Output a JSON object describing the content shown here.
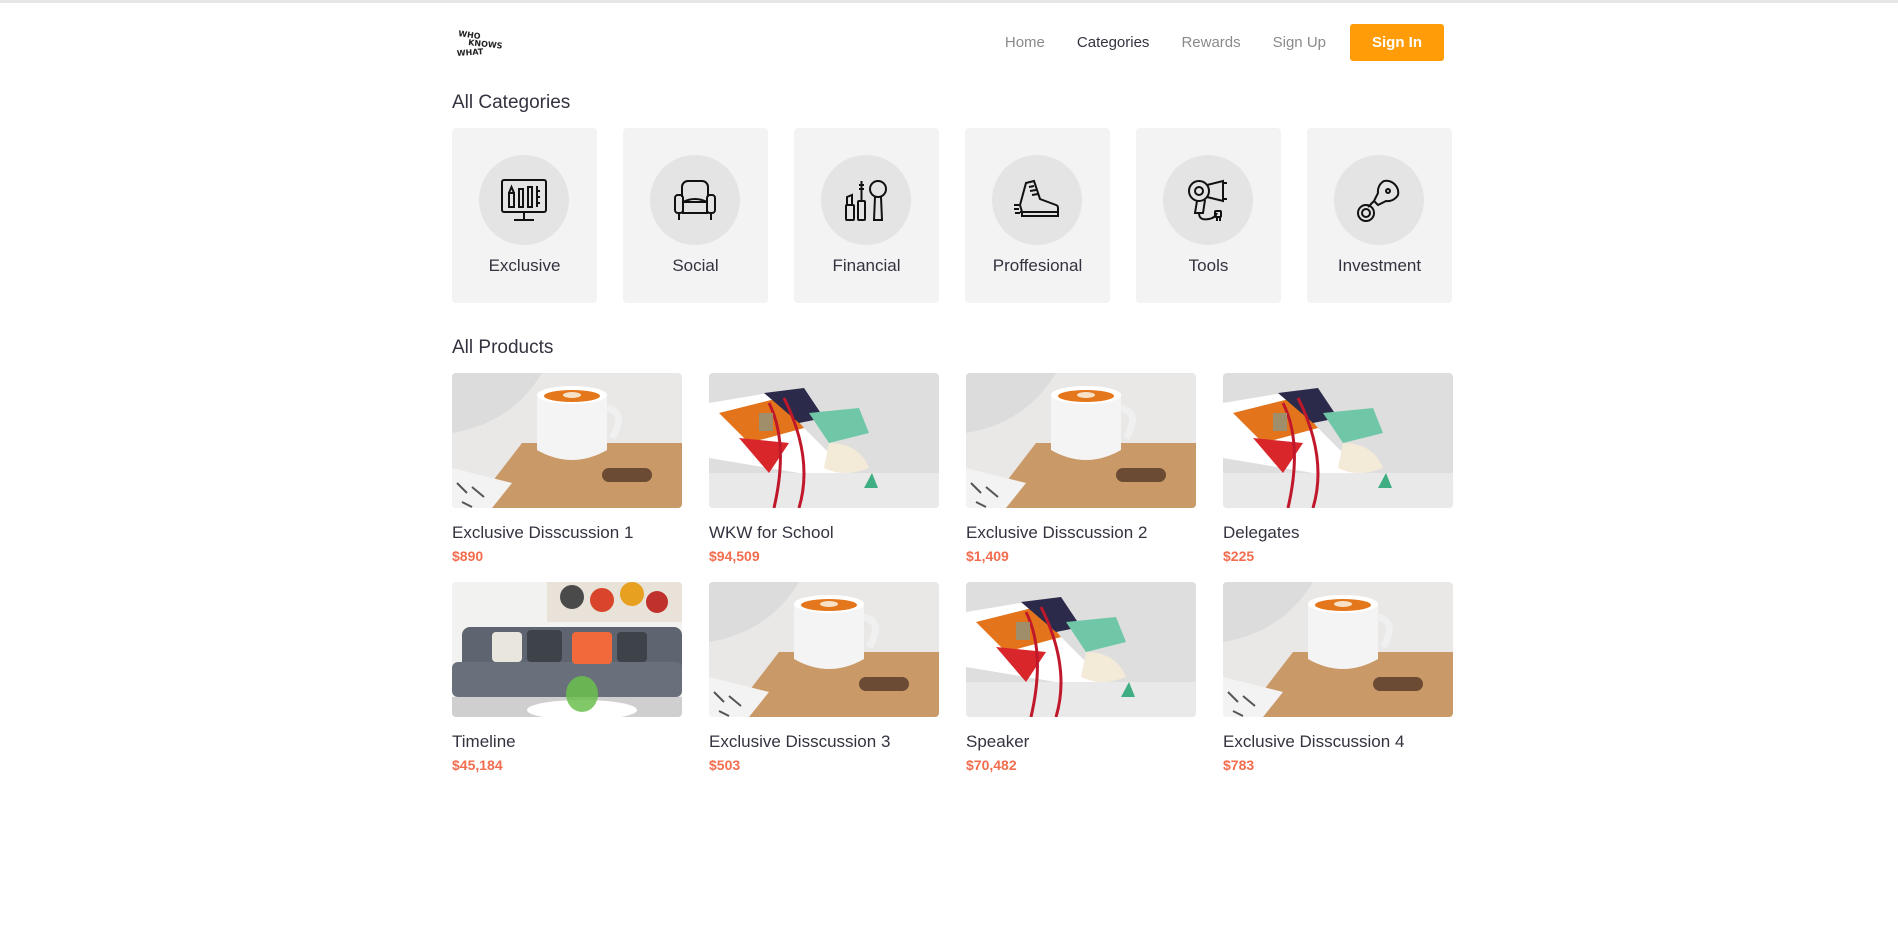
{
  "brand": {
    "logo_text_lines": [
      "WHO",
      "KNOWS",
      "WHAT"
    ]
  },
  "nav": {
    "items": [
      {
        "label": "Home",
        "active": false
      },
      {
        "label": "Categories",
        "active": true
      },
      {
        "label": "Rewards",
        "active": false
      },
      {
        "label": "Sign Up",
        "active": false
      }
    ],
    "signin_label": "Sign In"
  },
  "categories": {
    "title": "All Categories",
    "items": [
      {
        "label": "Exclusive",
        "icon": "monitor-tools-icon"
      },
      {
        "label": "Social",
        "icon": "armchair-icon"
      },
      {
        "label": "Financial",
        "icon": "cosmetics-icon"
      },
      {
        "label": "Proffesional",
        "icon": "sneaker-icon"
      },
      {
        "label": "Tools",
        "icon": "hair-dryer-icon"
      },
      {
        "label": "Investment",
        "icon": "pacifier-icon"
      }
    ]
  },
  "products": {
    "title": "All Products",
    "items": [
      {
        "name": "Exclusive Disscussion 1",
        "price": "$890",
        "image": "coffee"
      },
      {
        "name": "WKW for School",
        "price": "$94,509",
        "image": "sneaker"
      },
      {
        "name": "Exclusive Disscussion 2",
        "price": "$1,409",
        "image": "coffee"
      },
      {
        "name": "Delegates",
        "price": "$225",
        "image": "sneaker"
      },
      {
        "name": "Timeline",
        "price": "$45,184",
        "image": "sofa"
      },
      {
        "name": "Exclusive Disscussion 3",
        "price": "$503",
        "image": "coffee"
      },
      {
        "name": "Speaker",
        "price": "$70,482",
        "image": "sneaker"
      },
      {
        "name": "Exclusive Disscussion 4",
        "price": "$783",
        "image": "coffee"
      }
    ]
  },
  "colors": {
    "accent": "#ff9c07",
    "price": "#f26d4f",
    "card_bg": "#f3f3f3"
  }
}
